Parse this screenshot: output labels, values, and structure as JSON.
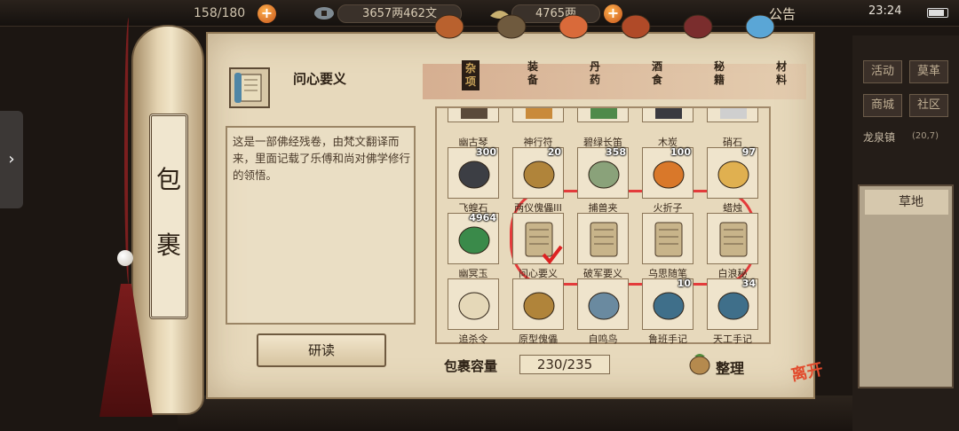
{
  "top_bar": {
    "stamina": "158/180",
    "money_strings": "3657两462文",
    "silver": "4765两",
    "notice_label": "公告",
    "clock": "23:24"
  },
  "right_panel": {
    "buttons": [
      "活动",
      "莫革",
      "商城",
      "社区"
    ],
    "town": "龙泉镇",
    "coord": "(20,7)",
    "terrain": "草地"
  },
  "scroll": {
    "title_chars": [
      "包",
      "裹"
    ]
  },
  "selected_item": {
    "name": "问心要义",
    "description": "这是一部佛经残卷，由梵文翻译而来，里面记载了乐傅和尚对佛学修行的领悟。",
    "read_button": "研读"
  },
  "tabs": [
    {
      "label": "杂项",
      "icon": "jar-icon",
      "active": true
    },
    {
      "label": "装备",
      "icon": "weapon-icon",
      "active": false
    },
    {
      "label": "丹药",
      "icon": "pill-icon",
      "active": false
    },
    {
      "label": "酒食",
      "icon": "food-icon",
      "active": false
    },
    {
      "label": "秘籍",
      "icon": "book-icon",
      "active": false
    },
    {
      "label": "材料",
      "icon": "crystal-icon",
      "active": false
    }
  ],
  "grid_items": [
    {
      "label": "幽古琴",
      "count": "",
      "icon": "zither-icon"
    },
    {
      "label": "神行符",
      "count": "",
      "icon": "talisman-icon"
    },
    {
      "label": "碧绿长笛",
      "count": "",
      "icon": "flute-icon"
    },
    {
      "label": "木炭",
      "count": "",
      "icon": "charcoal-icon"
    },
    {
      "label": "硝石",
      "count": "",
      "icon": "saltpeter-icon"
    },
    {
      "label": "飞蝗石",
      "count": "300",
      "icon": "stone-icon"
    },
    {
      "label": "两仪傀儡III",
      "count": "20",
      "icon": "puppet-icon"
    },
    {
      "label": "捕兽夹",
      "count": "358",
      "icon": "trap-icon"
    },
    {
      "label": "火折子",
      "count": "100",
      "icon": "firestarter-icon"
    },
    {
      "label": "蜡烛",
      "count": "97",
      "icon": "candle-icon"
    },
    {
      "label": "幽冥玉",
      "count": "4964",
      "icon": "jade-icon"
    },
    {
      "label": "问心要义",
      "count": "",
      "icon": "scroll-icon"
    },
    {
      "label": "破军要义",
      "count": "",
      "icon": "scroll-icon"
    },
    {
      "label": "乌思随笔",
      "count": "",
      "icon": "scroll-icon"
    },
    {
      "label": "白浪秘",
      "count": "",
      "icon": "scroll-icon"
    },
    {
      "label": "追杀令",
      "count": "",
      "icon": "paper-icon"
    },
    {
      "label": "原型傀儡",
      "count": "",
      "icon": "puppet-icon"
    },
    {
      "label": "自鸣鸟",
      "count": "",
      "icon": "bird-icon"
    },
    {
      "label": "鲁班手记",
      "count": "10",
      "icon": "manual-icon"
    },
    {
      "label": "天工手记",
      "count": "34",
      "icon": "manual-icon"
    }
  ],
  "footer": {
    "capacity_label": "包裹容量",
    "capacity_value": "230/235",
    "sort_label": "整理",
    "leave_label": "离开"
  }
}
